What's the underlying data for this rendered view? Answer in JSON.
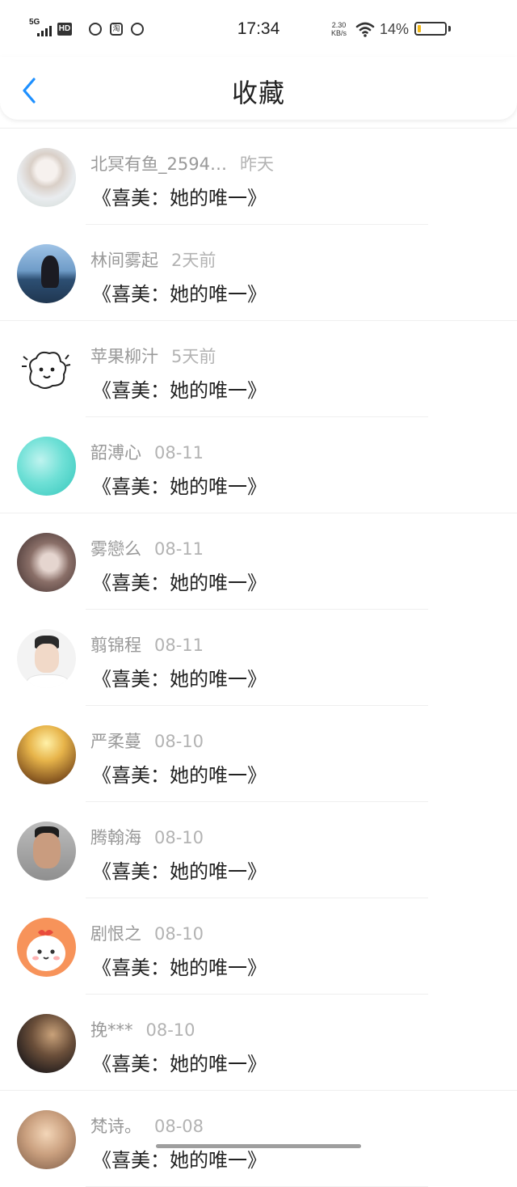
{
  "status_bar": {
    "network": "5G",
    "hd": "HD",
    "time": "17:34",
    "speed_value": "2.30",
    "speed_unit": "KB/s",
    "battery_text": "14%",
    "battery_level": 0.14,
    "battery_color": "#f2b816",
    "app_icons": [
      "quark-icon",
      "taobao-icon",
      "weibo-icon"
    ],
    "taobao_glyph": "淘"
  },
  "nav": {
    "title": "收藏",
    "back_icon": "chevron-left-icon",
    "accent_color": "#1e90ff"
  },
  "favorites": [
    {
      "user": "北冥有鱼_2594…",
      "time": "昨天",
      "book": "《喜美：她的唯一》"
    },
    {
      "user": "林间雾起",
      "time": "2天前",
      "book": "《喜美：她的唯一》"
    },
    {
      "user": "苹果柳汁",
      "time": "5天前",
      "book": "《喜美：她的唯一》"
    },
    {
      "user": "韶溥心",
      "time": "08-11",
      "book": "《喜美：她的唯一》"
    },
    {
      "user": "雾戀么",
      "time": "08-11",
      "book": "《喜美：她的唯一》"
    },
    {
      "user": "翦锦程",
      "time": "08-11",
      "book": "《喜美：她的唯一》"
    },
    {
      "user": "严柔蔓",
      "time": "08-10",
      "book": "《喜美：她的唯一》"
    },
    {
      "user": "腾翰海",
      "time": "08-10",
      "book": "《喜美：她的唯一》"
    },
    {
      "user": "剧恨之",
      "time": "08-10",
      "book": "《喜美：她的唯一》"
    },
    {
      "user": "挽***",
      "time": "08-10",
      "book": "《喜美：她的唯一》"
    },
    {
      "user": "梵诗。",
      "time": "08-08",
      "book": "《喜美：她的唯一》"
    }
  ]
}
